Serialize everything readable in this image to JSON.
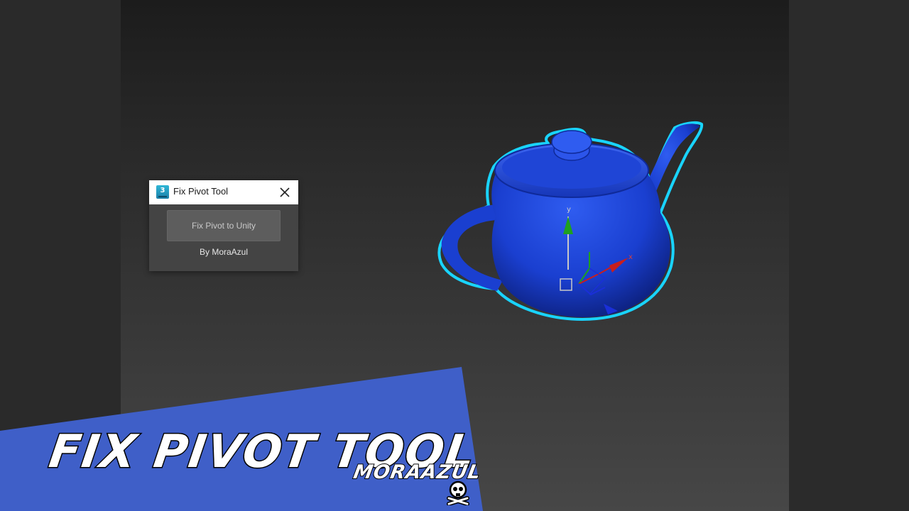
{
  "window": {
    "title": "Fix Pivot Tool",
    "app_icon_label": "3",
    "button_label": "Fix Pivot to Unity",
    "byline": "By MoraAzul"
  },
  "gizmo": {
    "y_axis_label": "y",
    "x_axis_label": "x"
  },
  "banner": {
    "title": "FIX PIVOT TOOL",
    "brand": "MORAAZUL"
  },
  "colors": {
    "background": "#262626",
    "dialog": "#444444",
    "teapot": "#1a3fd0",
    "selection_outline": "#19d4ff",
    "banner": "#3f5fc8"
  },
  "icons": {
    "app": "3ds-max-icon",
    "close": "close-icon",
    "logo": "skull-crossbones-icon"
  }
}
